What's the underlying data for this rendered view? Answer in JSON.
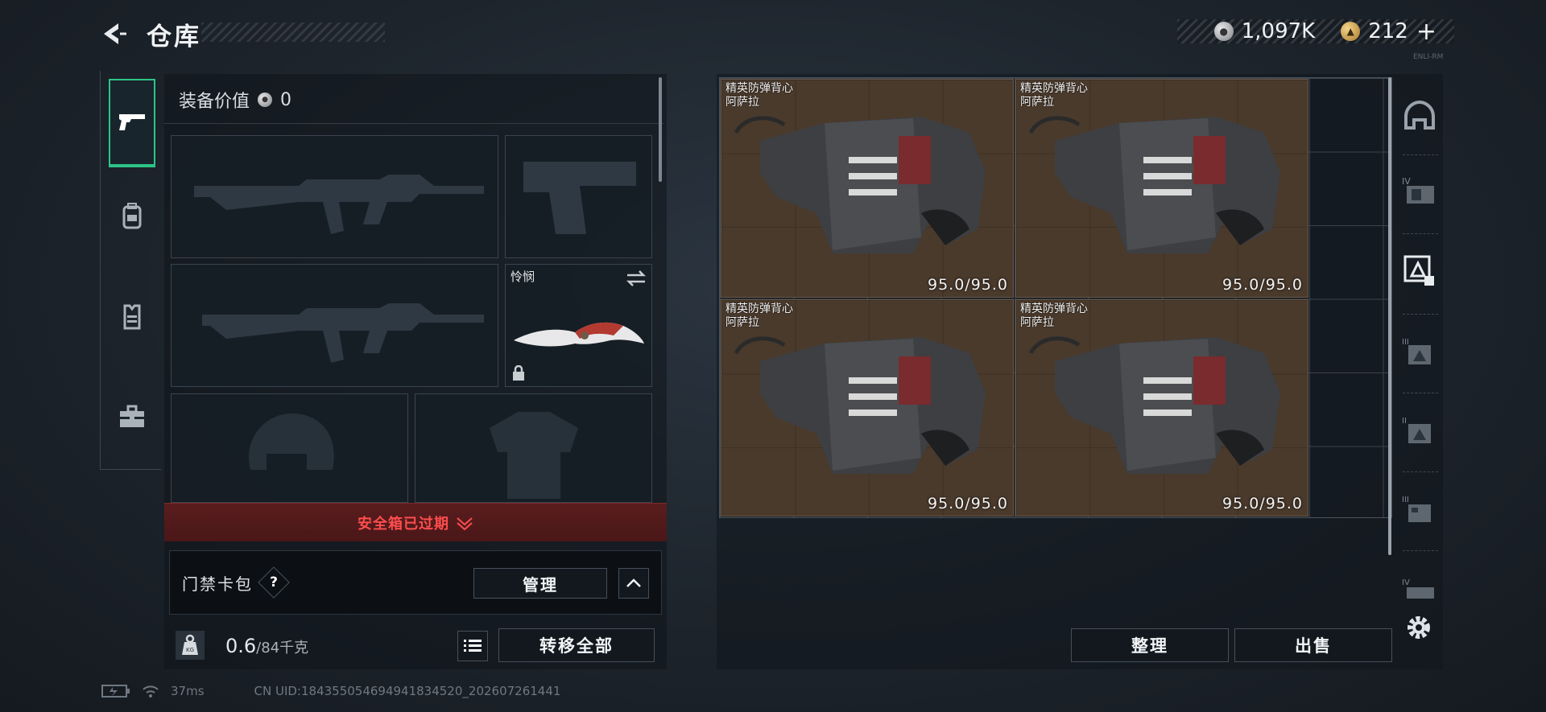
{
  "header": {
    "title": "仓库",
    "silver_amount": "1,097K",
    "gold_amount": "212",
    "gold_plus": "+",
    "tiny_label": "ENLI-RM"
  },
  "sidebar": {
    "tabs": [
      {
        "icon": "pistol-icon",
        "active": true
      },
      {
        "icon": "backpack-icon",
        "active": false
      },
      {
        "icon": "vest-rig-icon",
        "active": false
      },
      {
        "icon": "toolbox-icon",
        "active": false
      }
    ]
  },
  "loadout": {
    "equipment_value_label": "装备价值",
    "equipment_value": "0",
    "melee_slot_label": "怜悯",
    "safe_box_status": "安全箱已过期",
    "keycard_label": "门禁卡包",
    "keycard_help": "?",
    "manage_label": "管理",
    "weight_current": "0.6",
    "weight_max": "/84千克",
    "transfer_all_label": "转移全部"
  },
  "stash": {
    "items": [
      {
        "name_line1": "精英防弹背心",
        "name_line2": "阿萨拉",
        "durability": "95.0/95.0"
      },
      {
        "name_line1": "精英防弹背心",
        "name_line2": "阿萨拉",
        "durability": "95.0/95.0"
      },
      {
        "name_line1": "精英防弹背心",
        "name_line2": "阿萨拉",
        "durability": "95.0/95.0"
      },
      {
        "name_line1": "精英防弹背心",
        "name_line2": "阿萨拉",
        "durability": "95.0/95.0"
      }
    ],
    "sort_label": "整理",
    "sell_label": "出售"
  },
  "categories": [
    {
      "icon": "helmet-category-icon",
      "tier": ""
    },
    {
      "icon": "backpack-tier4-category-icon",
      "tier": "IV"
    },
    {
      "icon": "armor-category-icon",
      "tier": ""
    },
    {
      "icon": "armor-tier3-category-icon",
      "tier": "III"
    },
    {
      "icon": "armor-tier2-category-icon",
      "tier": "II"
    },
    {
      "icon": "rig-tier3-category-icon",
      "tier": "III"
    },
    {
      "icon": "backpack-tier4b-category-icon",
      "tier": "IV"
    }
  ],
  "status_bar": {
    "ping": "37ms",
    "uid": "CN UID:1843550546949418345​20_202607261441"
  },
  "colors": {
    "accent_green": "#2ec487",
    "alert_red": "#ff4d4d",
    "item_background": "#4a3a2c"
  }
}
